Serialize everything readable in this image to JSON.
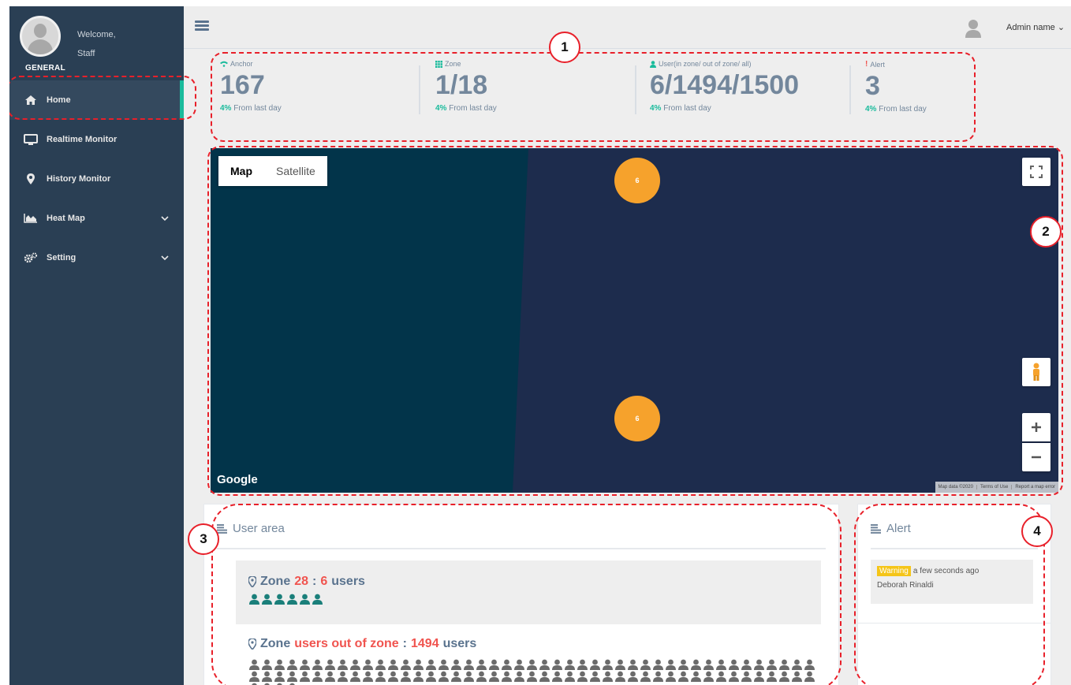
{
  "sidebar": {
    "welcome": "Welcome,",
    "user": "Staff",
    "section": "GENERAL",
    "items": [
      {
        "label": "Home",
        "icon": "home-icon"
      },
      {
        "label": "Realtime Monitor",
        "icon": "desktop-icon"
      },
      {
        "label": "History Monitor",
        "icon": "map-marker-icon"
      },
      {
        "label": "Heat Map",
        "icon": "area-chart-icon"
      },
      {
        "label": "Setting",
        "icon": "gears-icon"
      }
    ]
  },
  "header": {
    "admin": "Admin name"
  },
  "stats": [
    {
      "label": "Anchor",
      "value": "167",
      "pct": "4%",
      "note": "From last day",
      "icon": "wifi-icon"
    },
    {
      "label": "Zone",
      "value": "1/18",
      "pct": "4%",
      "note": "From last day",
      "icon": "grid-icon"
    },
    {
      "label": "User(in zone/ out of zone/ all)",
      "value": "6/1494/1500",
      "pct": "4%",
      "note": "From last day",
      "icon": "user-icon"
    },
    {
      "label": "Alert",
      "value": "3",
      "pct": "4%",
      "note": "From last day",
      "icon": "exclamation-icon"
    }
  ],
  "map": {
    "tab_map": "Map",
    "tab_satellite": "Satellite",
    "clusters": [
      "6",
      "6"
    ],
    "brand": "Google",
    "footer": [
      "Map data ©2020",
      "Terms of Use",
      "Report a map error"
    ]
  },
  "user_area": {
    "title": "User area",
    "zone1_prefix": "Zone",
    "zone1_id": "28",
    "zone1_sep": ":",
    "zone1_count": "6",
    "zone1_suffix": "users",
    "zone1_people": 6,
    "zone2_prefix": "Zone",
    "zone2_label": "users out of zone",
    "zone2_sep": ":",
    "zone2_count": "1494",
    "zone2_suffix": "users"
  },
  "alert_panel": {
    "title": "Alert",
    "badge": "Warning",
    "time": "a few seconds ago",
    "name": "Deborah Rinaldi"
  },
  "annotations": [
    "1",
    "2",
    "3",
    "4"
  ],
  "colors": {
    "sidebar": "#2a3f54",
    "accent": "#1abb9c",
    "cluster": "#f6a22c",
    "annotation": "#e8202a",
    "map": "#1d2c4d"
  }
}
